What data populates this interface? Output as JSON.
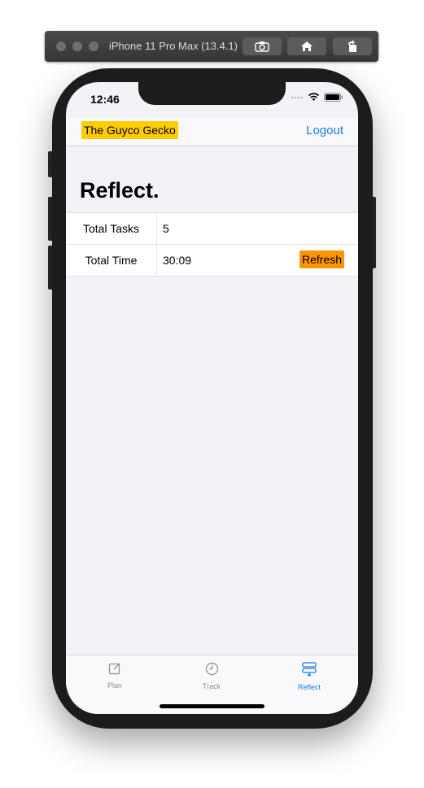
{
  "simulator": {
    "title": "iPhone 11 Pro Max (13.4.1)",
    "buttons": [
      "screenshot-icon",
      "home-icon",
      "rotate-icon"
    ]
  },
  "status_bar": {
    "time": "12:46",
    "icons": [
      "signal-icon",
      "wifi-icon",
      "battery-icon"
    ]
  },
  "nav": {
    "app_name": "The Guyco Gecko",
    "logout_label": "Logout"
  },
  "page": {
    "title": "Reflect."
  },
  "stats": [
    {
      "label": "Total Tasks",
      "value": "5"
    },
    {
      "label": "Total Time",
      "value": "30:09",
      "action": "Refresh"
    }
  ],
  "tabs": [
    {
      "label": "Plan",
      "icon": "compose-icon",
      "active": false
    },
    {
      "label": "Track",
      "icon": "clock-icon",
      "active": false
    },
    {
      "label": "Reflect",
      "icon": "stack-icon",
      "active": true
    }
  ],
  "colors": {
    "badge": "#ffcc00",
    "refresh": "#ff9500",
    "accent": "#1a7ee0",
    "background": "#f2f2f7"
  }
}
